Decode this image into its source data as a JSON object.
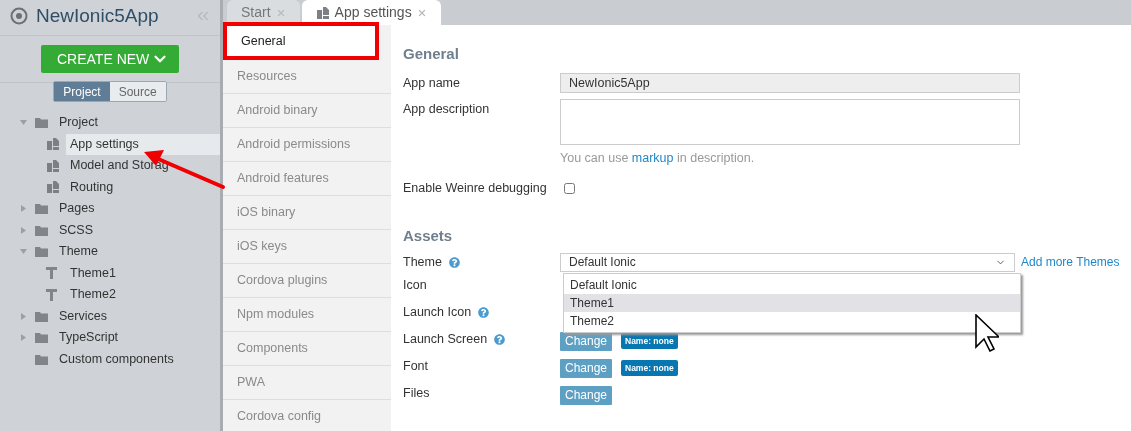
{
  "sidebar": {
    "app_name": "NewIonic5App",
    "create_button": "CREATE NEW",
    "view_tabs": [
      {
        "label": "Project",
        "selected": true
      },
      {
        "label": "Source",
        "selected": false
      }
    ],
    "tree": [
      {
        "label": "Project",
        "kind": "folder",
        "expanded": true,
        "selected": false,
        "children": [
          {
            "label": "App settings",
            "kind": "page",
            "selected": true
          },
          {
            "label": "Model and Storag",
            "kind": "page",
            "selected": false
          },
          {
            "label": "Routing",
            "kind": "page",
            "selected": false
          }
        ]
      },
      {
        "label": "Pages",
        "kind": "folder",
        "expanded": false,
        "selected": false
      },
      {
        "label": "SCSS",
        "kind": "folder",
        "expanded": false,
        "selected": false
      },
      {
        "label": "Theme",
        "kind": "folder",
        "expanded": true,
        "selected": false,
        "children": [
          {
            "label": "Theme1",
            "kind": "theme",
            "selected": false
          },
          {
            "label": "Theme2",
            "kind": "theme",
            "selected": false
          }
        ]
      },
      {
        "label": "Services",
        "kind": "folder",
        "expanded": false,
        "selected": false
      },
      {
        "label": "TypeScript",
        "kind": "folder",
        "expanded": false,
        "selected": false
      },
      {
        "label": "Custom components",
        "kind": "folder",
        "selected": false
      }
    ]
  },
  "tabs": [
    {
      "label": "Start",
      "selected": false
    },
    {
      "label": "App settings",
      "selected": true
    }
  ],
  "settings_nav": [
    {
      "label": "General",
      "selected": true
    },
    {
      "label": "Resources",
      "selected": false
    },
    {
      "label": "Android binary",
      "selected": false
    },
    {
      "label": "Android permissions",
      "selected": false
    },
    {
      "label": "Android features",
      "selected": false
    },
    {
      "label": "iOS binary",
      "selected": false
    },
    {
      "label": "iOS keys",
      "selected": false
    },
    {
      "label": "Cordova plugins",
      "selected": false
    },
    {
      "label": "Npm modules",
      "selected": false
    },
    {
      "label": "Components",
      "selected": false
    },
    {
      "label": "PWA",
      "selected": false
    },
    {
      "label": "Cordova config",
      "selected": false
    }
  ],
  "general": {
    "heading": "General",
    "app_name_label": "App name",
    "app_name_value": "NewIonic5App",
    "description_label": "App description",
    "hint_link": "markup",
    "hint_before": "You can use ",
    "hint_after": " in description.",
    "weinre_label": "Enable Weinre debugging",
    "weinre_checked": false
  },
  "assets": {
    "heading": "Assets",
    "theme_label": "Theme",
    "theme_value": "Default Ionic",
    "add_themes_link": "Add more Themes",
    "theme_options": [
      {
        "label": "Default Ionic",
        "selected": false
      },
      {
        "label": "Theme1",
        "selected": true
      },
      {
        "label": "Theme2",
        "selected": false
      }
    ],
    "rows": [
      {
        "label": "Icon",
        "help": false
      },
      {
        "label": "Launch Icon",
        "help": true
      },
      {
        "label": "Launch Screen",
        "help": true,
        "button": "Change",
        "badge": "Name: none"
      },
      {
        "label": "Font",
        "help": false,
        "button": "Change",
        "badge": "Name: none"
      },
      {
        "label": "Files",
        "help": false,
        "button": "Change"
      }
    ]
  }
}
